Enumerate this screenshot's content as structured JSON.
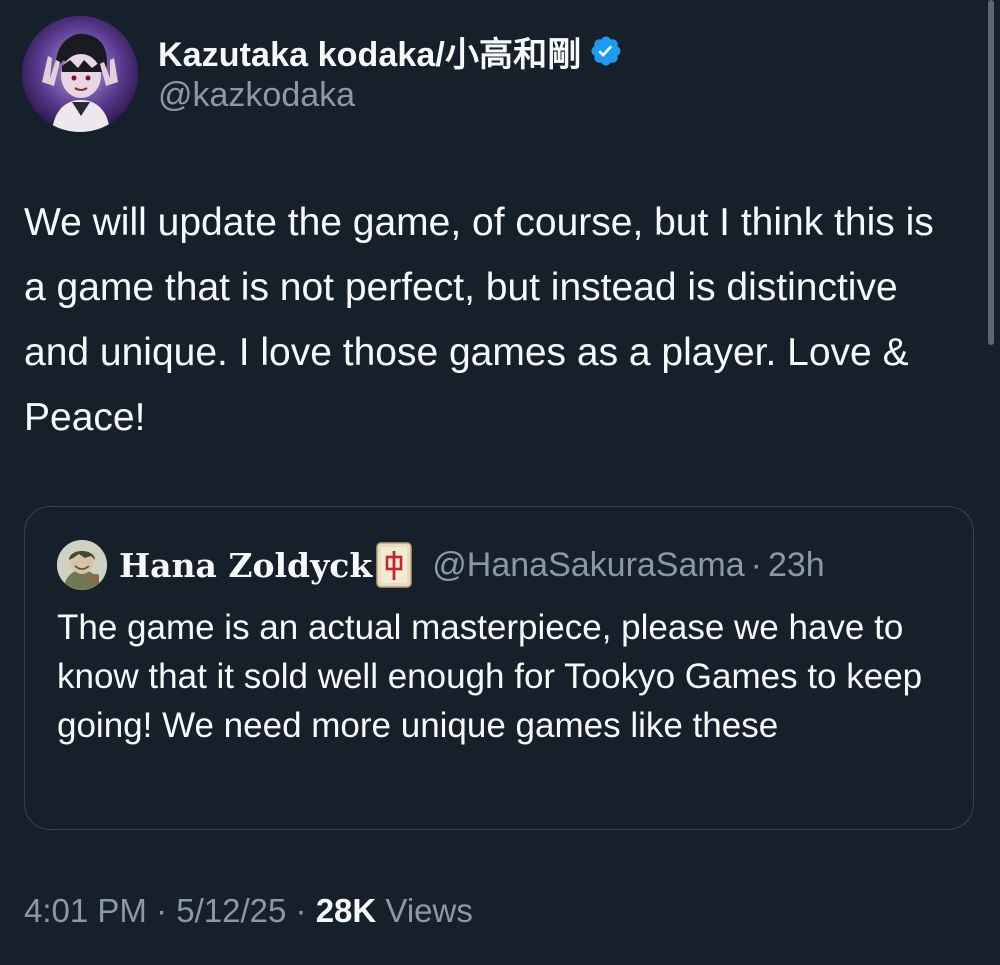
{
  "author": {
    "display_name": "Kazutaka kodaka/小高和剛",
    "handle": "@kazkodaka",
    "verified_icon": "verified-badge-icon",
    "badge_color": "#1d9bf0"
  },
  "tweet": {
    "text": "We will update the game, of course, but I think this is a game that is not perfect, but instead is distinctive and unique. I love those games as a player. Love & Peace!"
  },
  "quote": {
    "display_name": "Hana Zoldyck",
    "name_emoji_icon": "mahjong-red-dragon-icon",
    "handle": "@HanaSakuraSama",
    "separator": "·",
    "time": "23h",
    "text": "The game is an actual masterpiece, please we have to know that it sold well enough for Tookyo Games to keep going! We need more unique games like these"
  },
  "meta": {
    "time": "4:01 PM",
    "separator": "·",
    "date": "5/12/25",
    "views_count": "28K",
    "views_label": "Views"
  },
  "colors": {
    "background": "#15202b",
    "text_primary": "#f7f9f9",
    "text_secondary": "#8b98a5",
    "border": "#38444d"
  }
}
